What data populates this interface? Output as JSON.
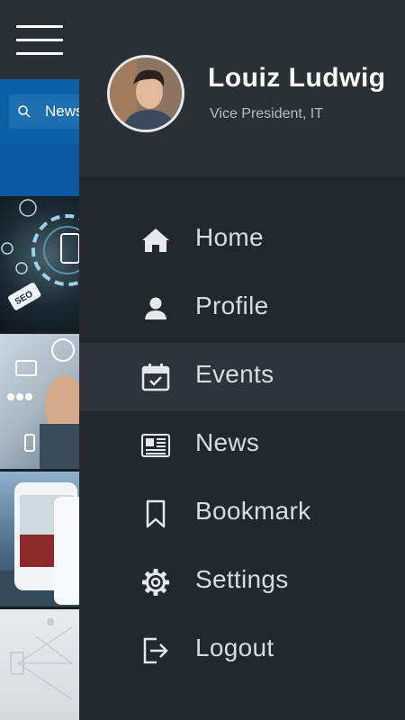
{
  "background_app": {
    "search_label": "News"
  },
  "user": {
    "name": "Louiz Ludwig",
    "title": "Vice President, IT"
  },
  "menu": {
    "items": [
      {
        "label": "Home",
        "icon": "home-icon"
      },
      {
        "label": "Profile",
        "icon": "user-icon"
      },
      {
        "label": "Events",
        "icon": "calendar-check-icon",
        "active": true
      },
      {
        "label": "News",
        "icon": "newspaper-icon"
      },
      {
        "label": "Bookmark",
        "icon": "bookmark-icon"
      },
      {
        "label": "Settings",
        "icon": "gear-icon"
      },
      {
        "label": "Logout",
        "icon": "logout-icon"
      }
    ]
  },
  "colors": {
    "drawer_bg": "#23272e",
    "header_bg": "#2b3037",
    "active_bg": "#2f343c",
    "accent_blue": "#0c5fa4"
  }
}
